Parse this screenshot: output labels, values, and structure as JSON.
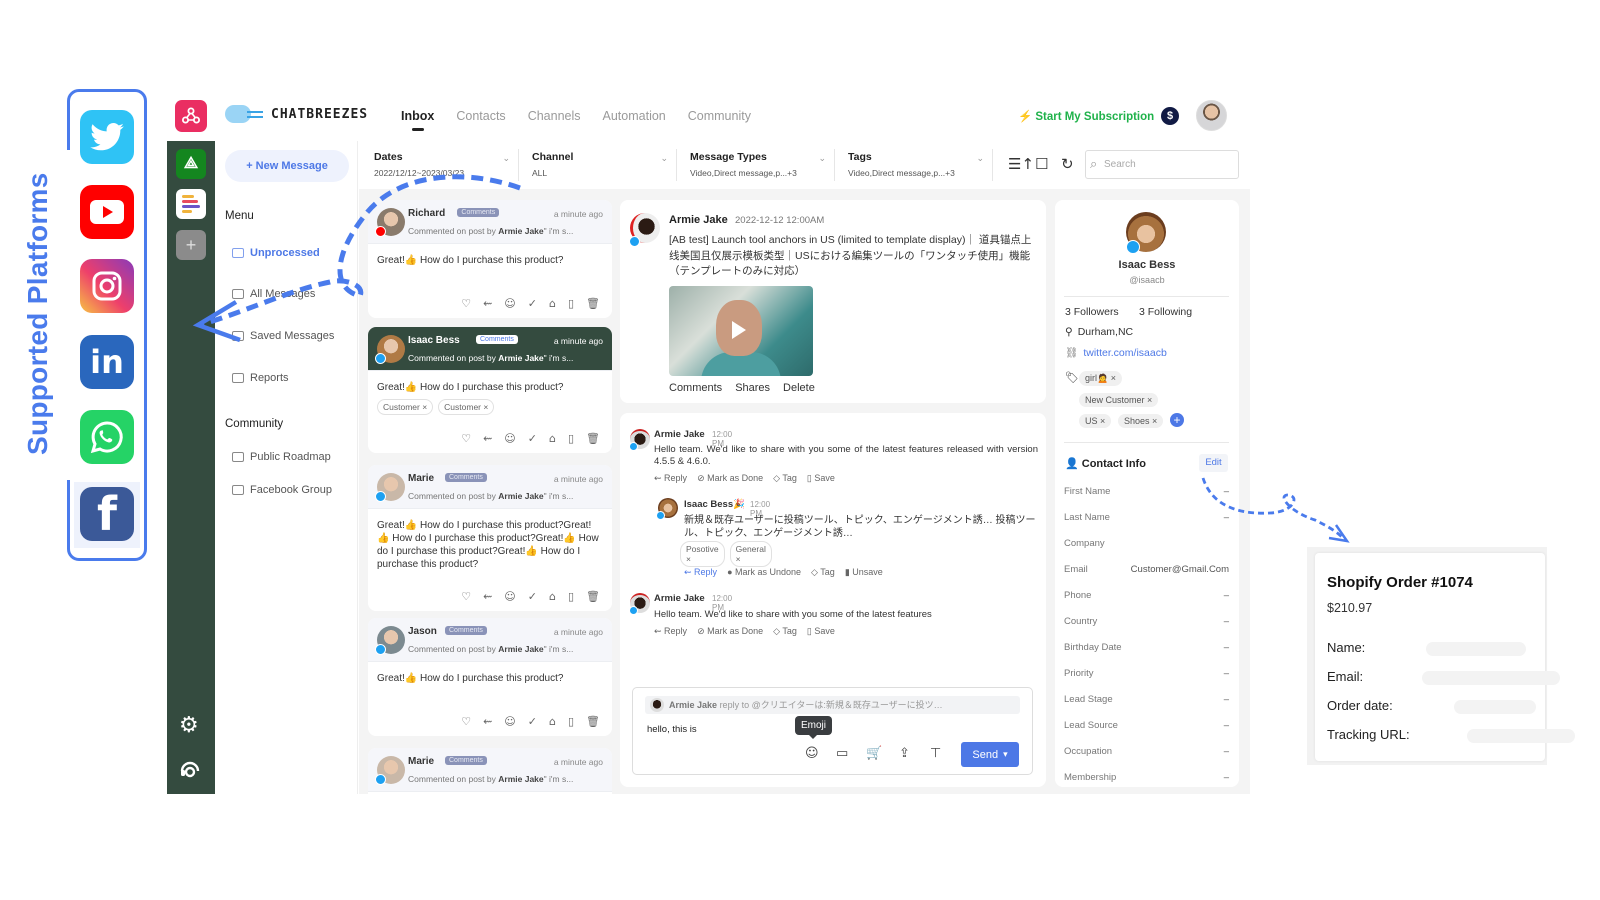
{
  "supported_platforms": {
    "title": "Supported Platforms",
    "items": [
      "Twitter",
      "YouTube",
      "Instagram",
      "LinkedIn",
      "WhatsApp",
      "Facebook"
    ],
    "linkedin_glyph": "in",
    "facebook_glyph": "f"
  },
  "brand": {
    "name": "CHATBREEZES"
  },
  "nav": {
    "items": [
      "Inbox",
      "Contacts",
      "Channels",
      "Automation",
      "Community"
    ],
    "active": "Inbox"
  },
  "header": {
    "subscription_label": "Start My Subscription",
    "dollar_glyph": "$"
  },
  "rail": {
    "add_glyph": "+",
    "app1_glyph": "⟁"
  },
  "sidebar": {
    "new_message_label": "+ New Message",
    "menu_heading": "Menu",
    "menu_items": [
      "Unprocessed",
      "All Messages",
      "Saved Messages",
      "Reports"
    ],
    "active_item": "Unprocessed",
    "community_heading": "Community",
    "community_items": [
      "Public Roadmap",
      "Facebook Group"
    ]
  },
  "filters": [
    {
      "label": "Dates",
      "value": "2022/12/12~2023/03/23"
    },
    {
      "label": "Channel",
      "value": "ALL"
    },
    {
      "label": "Message Types",
      "value": "Video,Direct message,p...+3"
    },
    {
      "label": "Tags",
      "value": "Video,Direct message,p...+3"
    }
  ],
  "toolbar": {
    "sort_glyph": "☰↑",
    "select_glyph": "☐",
    "refresh_glyph": "↻"
  },
  "search": {
    "placeholder": "Search"
  },
  "messages": [
    {
      "name": "Richard",
      "chip": "Comments",
      "time": "a minute ago",
      "sub_prefix": "Commented on post by",
      "sub_author": "Armie Jake",
      "sub_suffix": "\" i'm s...",
      "platform": "youtube",
      "body": "Great!👍 How do I purchase this product?",
      "tags": [],
      "selected": false
    },
    {
      "name": "Isaac Bess",
      "chip": "Comments",
      "time": "a minute ago",
      "sub_prefix": "Commented on post by",
      "sub_author": "Armie Jake",
      "sub_suffix": "\" i'm s...",
      "platform": "twitter",
      "body": "Great!👍 How do I purchase this product?",
      "tags": [
        "Customer ×",
        "Customer ×"
      ],
      "selected": true
    },
    {
      "name": "Marie",
      "chip": "Comments",
      "time": "a minute ago",
      "sub_prefix": "Commented on post by",
      "sub_author": "Armie Jake",
      "sub_suffix": "\" i'm s...",
      "platform": "twitter",
      "body": "Great!👍 How do I purchase this product?Great!👍 How do I purchase this product?Great!👍 How do I purchase this product?Great!👍 How do I purchase this product?",
      "tags": [],
      "selected": false
    },
    {
      "name": "Jason",
      "chip": "Comments",
      "time": "a minute ago",
      "sub_prefix": "Commented on post by",
      "sub_author": "Armie Jake",
      "sub_suffix": "\" i'm s...",
      "platform": "twitter",
      "body": "Great!👍 How do I purchase this product?",
      "tags": [],
      "selected": false
    },
    {
      "name": "Marie",
      "chip": "Comments",
      "time": "a minute ago",
      "sub_prefix": "Commented on post by",
      "sub_author": "Armie Jake",
      "sub_suffix": "\" i'm s...",
      "platform": "twitter",
      "body": "",
      "tags": [],
      "selected": false
    }
  ],
  "card_actions": [
    "♡",
    "⇜",
    "☺",
    "✓",
    "⌂",
    "▯",
    "🗑"
  ],
  "post": {
    "author": "Armie Jake",
    "date": "2022-12-12 12:00AM",
    "text": "[AB test] Launch tool anchors in US (limited to template display)｜ 道具锚点上线美国且仅展示模板类型｜USにおける編集ツールの「ワンタッチ使用」機能（テンプレートのみに対応）",
    "links": [
      "Comments",
      "Shares",
      "Delete"
    ]
  },
  "conversation": [
    {
      "author": "Armie Jake",
      "time": "12:00 PM",
      "text": "Hello team. We'd like to share with you some of the latest features released with version 4.5.5 & 4.6.0.",
      "actions": [
        "⇜ Reply",
        "⊘ Mark as Done",
        "◇ Tag",
        "▯ Save"
      ]
    },
    {
      "author": "Isaac Bess🎉",
      "time": "12:00 PM",
      "text": "新規＆既存ユーザーに投稿ツール、トピック、エンゲージメント誘… 投稿ツール、トピック、エンゲージメント誘…",
      "tags": [
        "Posotive ×",
        "General ×"
      ],
      "actions": [
        "⇜ Reply",
        "● Mark as Undone",
        "◇ Tag",
        "▮ Unsave"
      ]
    },
    {
      "author": "Armie Jake",
      "time": "12:00 PM",
      "text": "Hello team. We'd like to share with you some of the latest features",
      "actions": [
        "⇜ Reply",
        "⊘ Mark as Done",
        "◇ Tag",
        "▯ Save"
      ]
    }
  ],
  "composer": {
    "reply_author": "Armie Jake",
    "reply_to_text": "reply to @クリエイターは:新規＆既存ユーザーに投ツ…",
    "input_value": "hello, this is",
    "tooltip": "Emoji",
    "icons": [
      "☺",
      "▭",
      "🛒",
      "⇪",
      "⊤"
    ],
    "send_label": "Send",
    "send_caret": "▾"
  },
  "profile": {
    "name": "Isaac Bess",
    "handle": "@isaacb",
    "followers": "3 Followers",
    "following": "3 Following",
    "location": "Durham,NC",
    "link": "twitter.com/isaacb",
    "tags": [
      "girl🙍 ×",
      "New Customer ×",
      "US ×",
      "Shoes ×"
    ],
    "add_tag_glyph": "+",
    "contact_info_title": "Contact Info",
    "edit_label": "Edit",
    "fields": [
      {
        "label": "First Name",
        "value": "–"
      },
      {
        "label": "Last Name",
        "value": "–"
      },
      {
        "label": "Company",
        "value": ""
      },
      {
        "label": "Email",
        "value": "Customer@Gmail.Com"
      },
      {
        "label": "Phone",
        "value": "–"
      },
      {
        "label": "Country",
        "value": "–"
      },
      {
        "label": "Birthday Date",
        "value": "–"
      },
      {
        "label": "Priority",
        "value": "–"
      },
      {
        "label": "Lead Stage",
        "value": "–"
      },
      {
        "label": "Lead Source",
        "value": "–"
      },
      {
        "label": "Occupation",
        "value": "–"
      },
      {
        "label": "Membership",
        "value": "–"
      }
    ]
  },
  "shopify": {
    "title": "Shopify Order #1074",
    "amount": "$210.97",
    "fields": [
      "Name:",
      "Email:",
      "Order date:",
      "Tracking URL:"
    ]
  },
  "colors": {
    "accent": "#4d78e6",
    "annotation": "#4a7bec",
    "rail": "#344b3f",
    "subscribe": "#1fb24a"
  }
}
